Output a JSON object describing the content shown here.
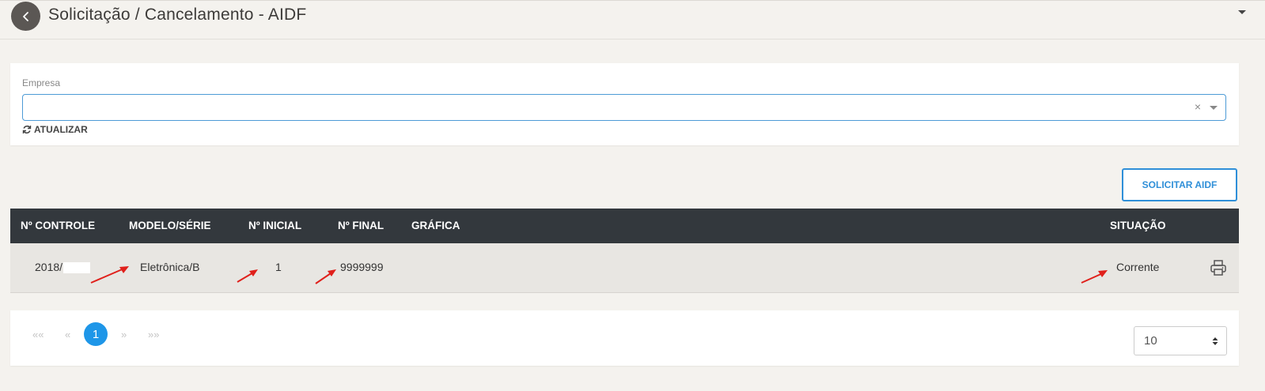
{
  "header": {
    "title": "Solicitação / Cancelamento - AIDF",
    "back_icon": "chevron-left-icon",
    "menu_icon": "caret-down-icon"
  },
  "filter": {
    "empresa_label": "Empresa",
    "empresa_value": "",
    "clear_symbol": "×",
    "refresh_label": "ATUALIZAR"
  },
  "actions": {
    "solicitar_label": "SOLICITAR AIDF"
  },
  "table": {
    "headers": {
      "controle": "Nº CONTROLE",
      "modelo": "MODELO/SÉRIE",
      "inicial": "Nº INICIAL",
      "final": "Nº FINAL",
      "grafica": "GRÁFICA",
      "situacao": "SITUAÇÃO"
    },
    "rows": [
      {
        "controle": "2018/",
        "modelo": "Eletrônica/B",
        "inicial": "1",
        "final": "9999999",
        "grafica": "",
        "situacao": "Corrente",
        "action_icon": "printer-icon"
      }
    ]
  },
  "pagination": {
    "first": "««",
    "prev": "«",
    "current": "1",
    "next": "»",
    "last": "»»",
    "page_size": "10"
  },
  "colors": {
    "accent": "#1e96e8",
    "header_bg": "#33383d",
    "annotation_arrow": "#e0201b"
  }
}
